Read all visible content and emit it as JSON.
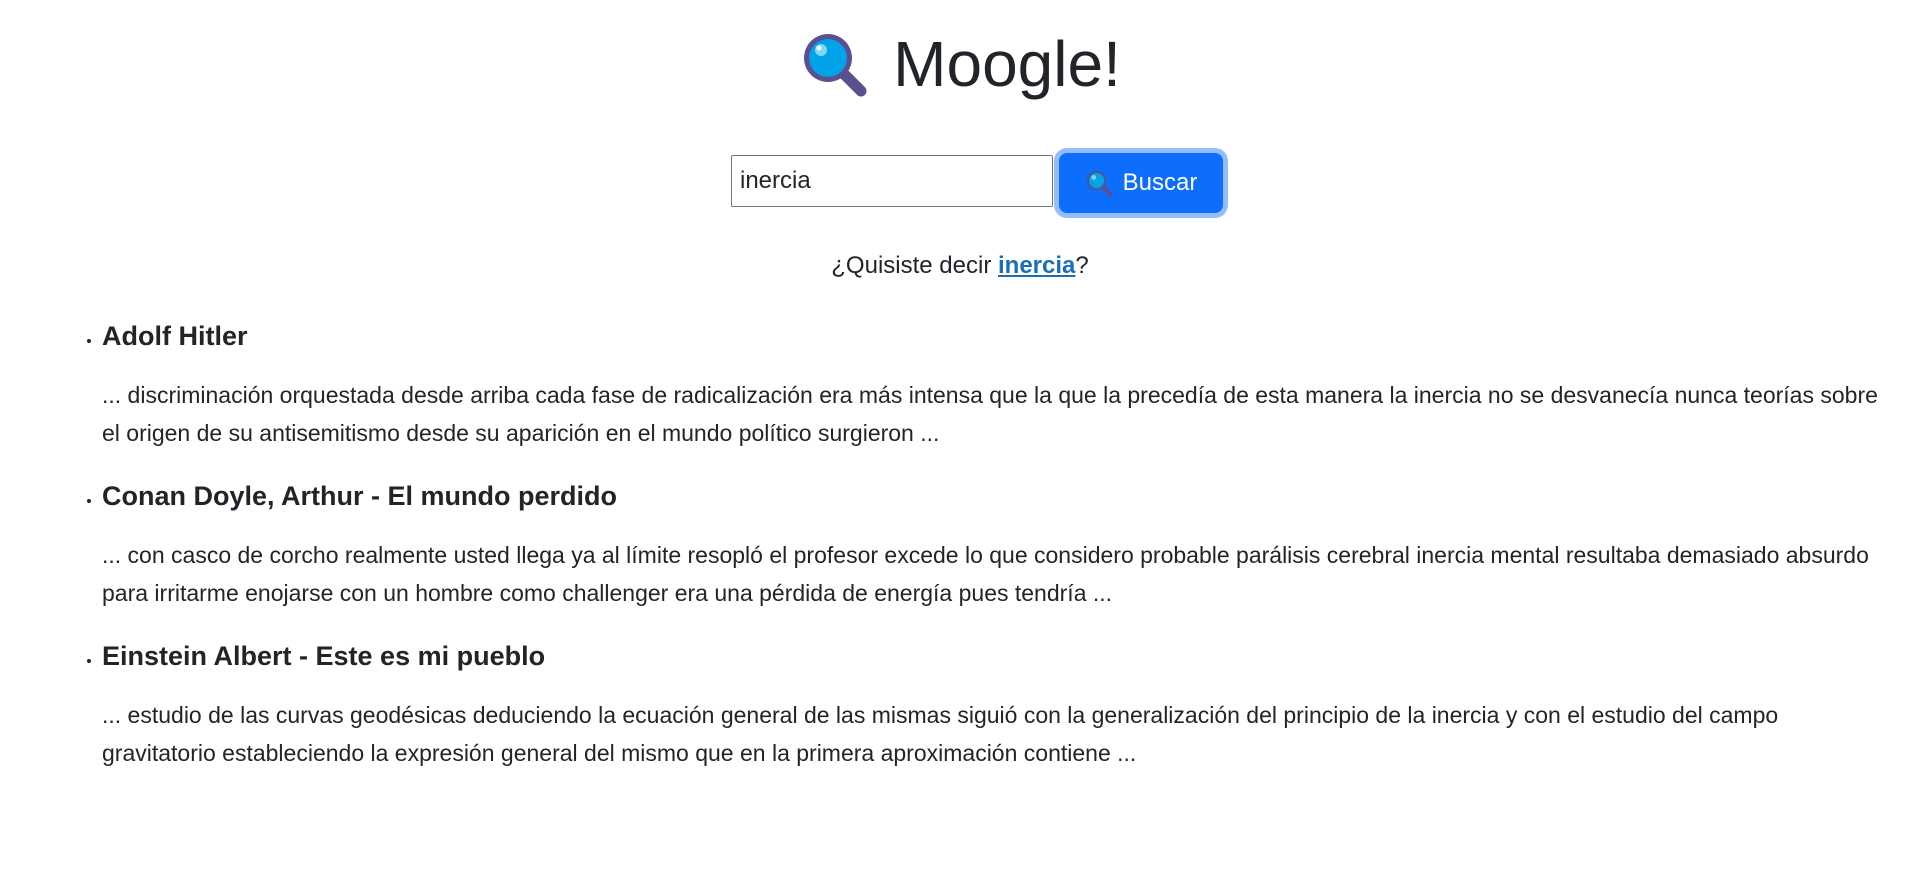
{
  "header": {
    "title": "Moogle!",
    "icon": "magnifying-glass-icon"
  },
  "search": {
    "value": "inercia",
    "button_label": "Buscar",
    "button_icon": "magnifying-glass-icon"
  },
  "suggestion": {
    "prefix": "¿Quisiste decir ",
    "word": "inercia",
    "suffix": "?"
  },
  "results": [
    {
      "title": "Adolf Hitler",
      "snippet": "... discriminación orquestada desde arriba cada fase de radicalización era más intensa que la que la precedía de esta manera la inercia no se desvanecía nunca teorías sobre el origen de su antisemitismo desde su aparición en el mundo político surgieron ..."
    },
    {
      "title": "Conan Doyle, Arthur - El mundo perdido",
      "snippet": "... con casco de corcho realmente usted llega ya al límite resopló el profesor excede lo que considero probable parálisis cerebral inercia mental resultaba demasiado absurdo para irritarme enojarse con un hombre como challenger era una pérdida de energía pues tendría ..."
    },
    {
      "title": "Einstein Albert - Este es mi pueblo",
      "snippet": "... estudio de las curvas geodésicas deduciendo la ecuación general de las mismas siguió con la generalización del principio de la inercia y con el estudio del campo gravitatorio estableciendo la expresión general del mismo que en la primera aproximación contiene ..."
    }
  ],
  "colors": {
    "accent": "#0d6efd",
    "link": "#1a6fb5",
    "text": "#212529"
  }
}
